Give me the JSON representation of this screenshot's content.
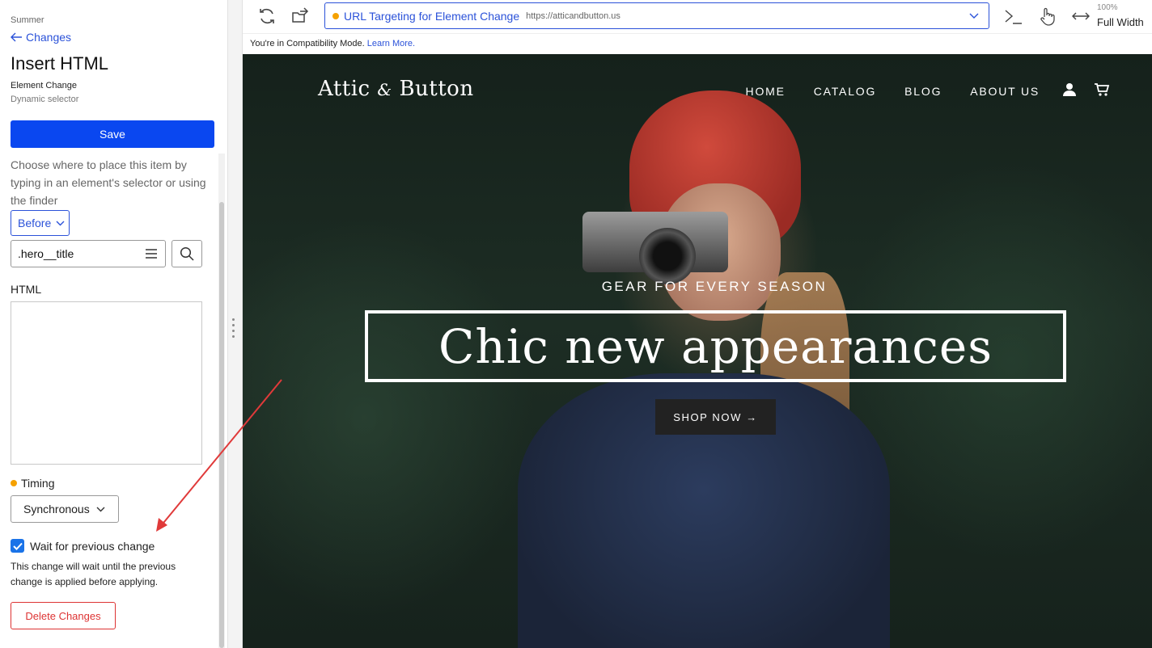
{
  "panel": {
    "breadcrumb": "Summer",
    "back_label": "Changes",
    "title": "Insert HTML",
    "subtitle": "Element Change",
    "subtitle2": "Dynamic selector",
    "save_label": "Save",
    "help_text": "Choose where to place this item by typing in an element's selector or using the finder",
    "position_value": "Before",
    "selector_value": ".hero__title",
    "html_label": "HTML",
    "html_value": "",
    "timing_label": "Timing",
    "timing_value": "Synchronous",
    "wait_label": "Wait for previous change",
    "wait_checked": true,
    "wait_help": "This change will wait until the previous change is applied before applying.",
    "delete_label": "Delete Changes"
  },
  "toolbar": {
    "url_name": "URL Targeting for Element Change",
    "url_address": "https://atticandbutton.us",
    "zoom_percent": "100%",
    "zoom_label": "Full Width",
    "icons": [
      "refresh-icon",
      "open-external-icon",
      "chevron-down-icon",
      "console-icon",
      "pointer-hand-icon",
      "resize-horizontal-icon"
    ]
  },
  "compat": {
    "message": "You're in Compatibility Mode.",
    "link": "Learn More."
  },
  "site": {
    "logo_left": "Attic",
    "logo_amp": "&",
    "logo_right": "Button",
    "nav": [
      "HOME",
      "CATALOG",
      "BLOG",
      "ABOUT US"
    ],
    "hero_sub": "GEAR FOR EVERY SEASON",
    "hero_title": "Chic new appearances",
    "cta": "SHOP NOW →"
  },
  "colors": {
    "accent": "#2b52d9",
    "save_bg": "#0a47f0",
    "danger": "#dd3333",
    "timing_dot": "#f5a100",
    "annotation": "#e03a3a"
  }
}
